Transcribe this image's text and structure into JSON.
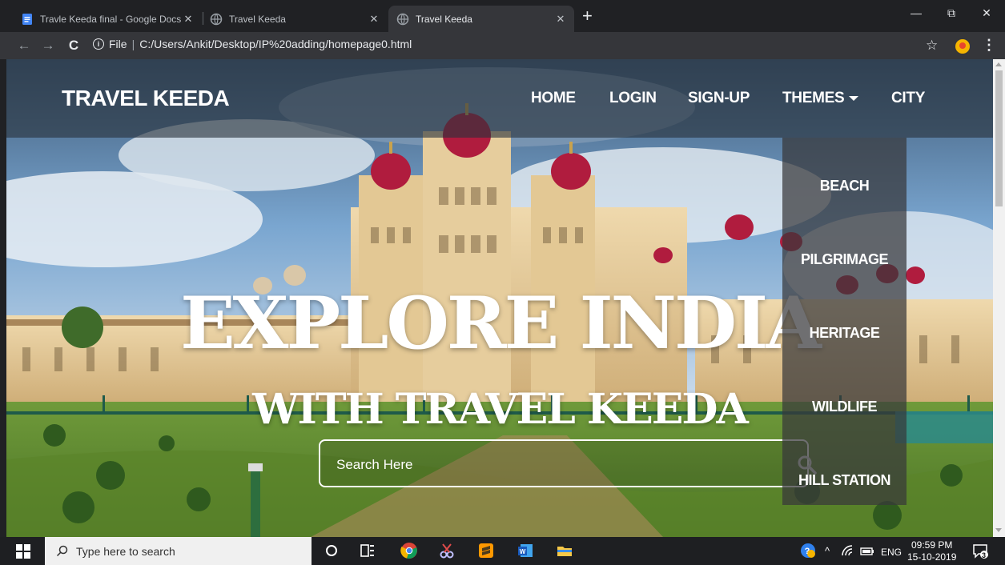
{
  "browser": {
    "tabs": [
      {
        "title": "Travle Keeda final - Google Docs",
        "active": false
      },
      {
        "title": "Travel Keeda",
        "active": false
      },
      {
        "title": "Travel Keeda",
        "active": true
      }
    ],
    "new_tab_symbol": "+",
    "window_controls": {
      "minimize": "—",
      "restore": "⧉",
      "close": "✕"
    },
    "address": {
      "scheme_label": "File",
      "url": "C:/Users/Ankit/Desktop/IP%20adding/homepage0.html"
    },
    "nav": {
      "back": "←",
      "forward": "→",
      "reload": "C"
    },
    "star_symbol": "☆",
    "menu_symbol": "⋮"
  },
  "site": {
    "brand": "TRAVEL KEEDA",
    "nav": {
      "home": "HOME",
      "login": "LOGIN",
      "signup": "SIGN-UP",
      "themes": "THEMES",
      "city": "CITY"
    },
    "themes_menu": [
      "BEACH",
      "PILGRIMAGE",
      "HERITAGE",
      "WILDLIFE",
      "HILL STATION"
    ],
    "hero_title": "EXPLORE INDIA",
    "hero_subtitle": "WITH TRAVEL KEEDA",
    "search_placeholder": "Search Here"
  },
  "taskbar": {
    "search_placeholder": "Type here to search",
    "language": "ENG",
    "time": "09:59 PM",
    "date": "15-10-2019",
    "notification_count": "3",
    "tray_chevron": "^"
  },
  "colors": {
    "chrome_dark": "#202124",
    "chrome_toolbar": "#35363a",
    "palace_facade": "#e6cda0",
    "palace_dome": "#b01c3e",
    "lawn_green": "#5e8a30",
    "sky_blue": "#6d9ccb"
  }
}
